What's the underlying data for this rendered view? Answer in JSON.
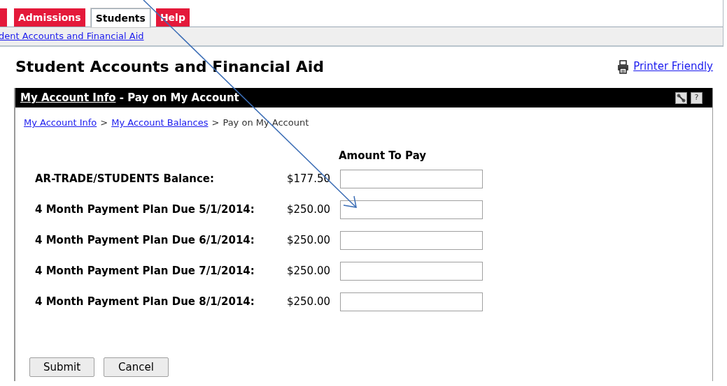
{
  "tabs": [
    {
      "label": "Admissions",
      "selected": false
    },
    {
      "label": "Students",
      "selected": true
    },
    {
      "label": "Help",
      "selected": false
    }
  ],
  "sub_nav": {
    "link": "dent Accounts and Financial Aid"
  },
  "page_title": "Student Accounts and Financial Aid",
  "printer_friendly": "Printer Friendly",
  "panel": {
    "title_link": "My Account Info",
    "title_rest": " - Pay on My Account"
  },
  "breadcrumb": {
    "links": [
      "My Account Info",
      "My Account Balances"
    ],
    "current": "Pay on My Account",
    "separator": ">"
  },
  "form": {
    "column_heading": "Amount To Pay",
    "rows": [
      {
        "label": "AR-TRADE/STUDENTS Balance:",
        "amount": "$177.50"
      },
      {
        "label": "4 Month Payment Plan Due 5/1/2014:",
        "amount": "$250.00"
      },
      {
        "label": "4 Month Payment Plan Due 6/1/2014:",
        "amount": "$250.00"
      },
      {
        "label": "4 Month Payment Plan Due 7/1/2014:",
        "amount": "$250.00"
      },
      {
        "label": "4 Month Payment Plan Due 8/1/2014:",
        "amount": "$250.00"
      }
    ]
  },
  "buttons": [
    "Submit",
    "Cancel"
  ],
  "help_icon": "?"
}
